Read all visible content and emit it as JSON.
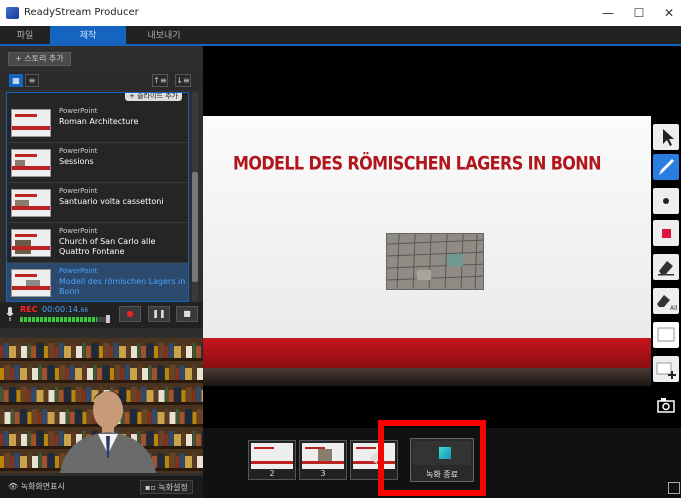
{
  "window": {
    "title": "ReadyStream Producer",
    "controls": {
      "minimize": "—",
      "maximize": "☐",
      "close": "✕"
    }
  },
  "menu": {
    "tabs": [
      "파일",
      "제작",
      "내보내기"
    ],
    "active": 1
  },
  "story": {
    "add_label": "+ 스토리 추가",
    "add_slide_label": "+ 슬라이드 추가"
  },
  "slides": [
    {
      "type": "PowerPoint",
      "name": "Roman Architecture"
    },
    {
      "type": "PowerPoint",
      "name": "Sessions"
    },
    {
      "type": "PowerPoint",
      "name": "Santuario volta cassettoni"
    },
    {
      "type": "PowerPoint",
      "name": "Church of San Carlo alle Quattro Fontane"
    },
    {
      "type": "PowerPoint",
      "name": "Modell des römischen Lagers in Bonn"
    }
  ],
  "recording": {
    "rec_label": "REC",
    "time_main": "00:00:14.",
    "time_frac": "66",
    "level": 0.85
  },
  "webcam": {
    "show_label": "녹화화면표시",
    "settings_label": "녹화설정"
  },
  "current_slide": {
    "title": "MODELL DES RÖMISCHEN LAGERS IN BONN"
  },
  "strip": {
    "thumb_numbers": [
      "2",
      "3"
    ],
    "rec_end_label": "녹화 종료"
  },
  "colors": {
    "accent": "#1565c0",
    "slide_red": "#b0161c",
    "highlight": "#ff0000",
    "rec_red": "#ff2222"
  },
  "icons": [
    "pointer-icon",
    "pen-icon",
    "dot-icon",
    "color-swatch-icon",
    "eraser-icon",
    "eraser-all-icon",
    "whiteboard-icon",
    "add-board-icon",
    "capture-icon"
  ]
}
